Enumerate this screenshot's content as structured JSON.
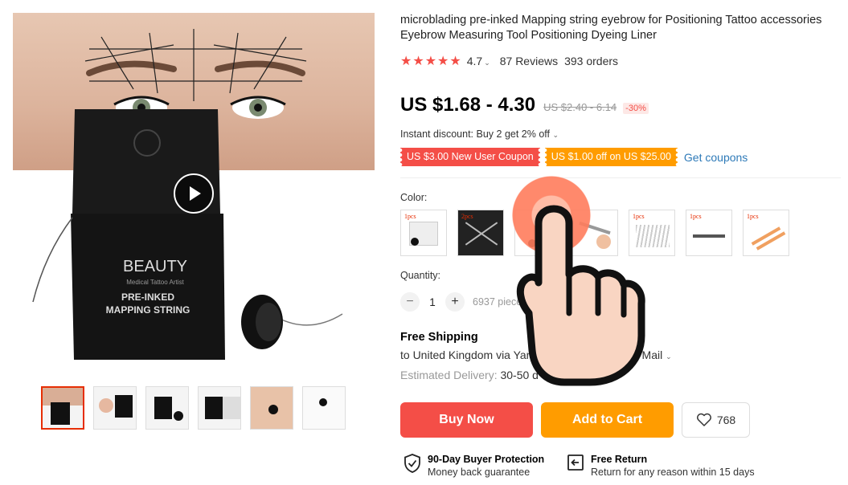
{
  "product": {
    "title": "microblading pre-inked Mapping string eyebrow for Positioning Tattoo accessories Eyebrow Measuring Tool Positioning Dyeing Liner",
    "rating": "4.7",
    "reviews": "87 Reviews",
    "orders": "393 orders",
    "price": "US $1.68 - 4.30",
    "old_price": "US $2.40 - 6.14",
    "discount": "-30%"
  },
  "image": {
    "box_brand": "BEAUTY",
    "box_sub": "Medical Tattoo Artist",
    "box_line1": "PRE-INKED",
    "box_line2": "MAPPING STRING"
  },
  "promo": {
    "instant": "Instant discount: Buy 2 get 2% off",
    "coupon1": "US $3.00 New User Coupon",
    "coupon2": "US $1.00 off on US $25.00",
    "get_coupons": "Get coupons"
  },
  "color": {
    "label": "Color:",
    "swatches": [
      "1pcs",
      "2pcs",
      "",
      "",
      "1pcs",
      "1pcs",
      "1pcs"
    ]
  },
  "quantity": {
    "label": "Quantity:",
    "minus": "−",
    "value": "1",
    "plus": "+",
    "available": "6937 piece"
  },
  "shipping": {
    "title": "Free Shipping",
    "to": "to United Kingdom via Yan",
    "end": "r Mail",
    "delivery_label": "Estimated Delivery:",
    "delivery_value": "30-50 d"
  },
  "actions": {
    "buy_now": "Buy Now",
    "add_to_cart": "Add to Cart",
    "wishlist_count": "768"
  },
  "guarantees": {
    "protection_title": "90-Day Buyer Protection",
    "protection_sub": "Money back guarantee",
    "return_title": "Free Return",
    "return_sub": "Return for any reason within 15 days"
  },
  "colors": {
    "accent_red": "#f44e47",
    "accent_orange": "#ff9c00",
    "link_blue": "#2e7ab8"
  }
}
